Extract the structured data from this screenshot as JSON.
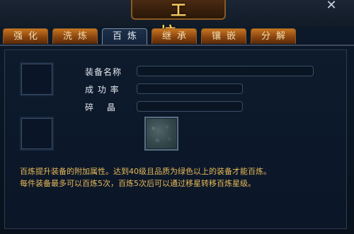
{
  "window": {
    "title": "工 坊",
    "close_glyph": "✕"
  },
  "tabs": [
    {
      "label": "强化",
      "active": false
    },
    {
      "label": "洗炼",
      "active": false
    },
    {
      "label": "百炼",
      "active": true
    },
    {
      "label": "继承",
      "active": false
    },
    {
      "label": "镶嵌",
      "active": false
    },
    {
      "label": "分解",
      "active": false
    }
  ],
  "form": {
    "equipment_name_label": "装备名称",
    "equipment_name_value": "",
    "success_rate_label": "成 功 率",
    "success_rate_value": "",
    "fragment_label": "碎　 晶",
    "fragment_value": ""
  },
  "description": {
    "line1": "百炼提升装备的附加属性。达到40级且品质为绿色以上的装备才能百炼。",
    "line2": "每件装备最多可以百炼5次，百炼5次后可以通过移星转移百炼星级。"
  },
  "colors": {
    "title": "#f6c860",
    "description": "#e8b95a",
    "tab": "#c77520",
    "tab_active": "#1d3149"
  }
}
